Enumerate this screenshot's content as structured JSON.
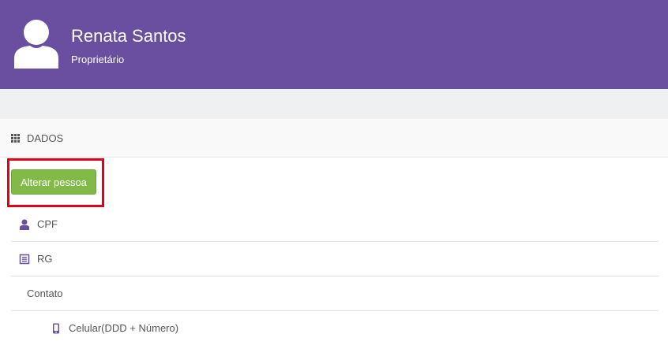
{
  "header": {
    "user_name": "Renata Santos",
    "user_role": "Proprietário",
    "avatar_icon": "user-avatar-icon",
    "background_color": "#6a4fa1"
  },
  "section": {
    "title": "DADOS",
    "icon": "grid-icon"
  },
  "actions": {
    "alter_button_label": "Alterar pessoa",
    "button_color": "#82ba48",
    "highlight_color": "#e2001a"
  },
  "fields": [
    {
      "label": "CPF",
      "icon": "user-icon"
    },
    {
      "label": "RG",
      "icon": "id-card-icon"
    },
    {
      "label": "Contato"
    },
    {
      "label": "Celular(DDD + Número)",
      "icon": "mobile-phone-icon"
    }
  ],
  "accent_color": "#6a4fa1"
}
